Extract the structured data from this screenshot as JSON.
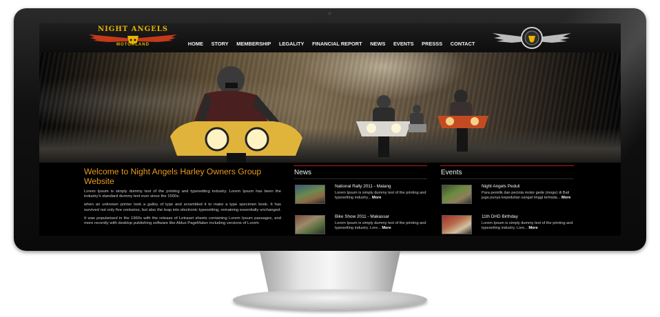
{
  "site": {
    "logo_title": "NIGHT ANGELS",
    "logo_subtitle": "MOTORLAND",
    "emblem_icon": "winged-eagle-badge-icon"
  },
  "nav": {
    "items": [
      "HOME",
      "STORY",
      "MEMBERSHIP",
      "LEGALITY",
      "FINANCIAL REPORT",
      "NEWS",
      "EVENTS",
      "PRESSS",
      "CONTACT"
    ]
  },
  "welcome": {
    "title": "Welcome to Night Angels Harley Owners Group Website",
    "paragraphs": [
      "Lorem Ipsum is simply dummy text of the printing and typesetting industry. Lorem Ipsum has been the industry's standard dummy text ever since the 1500s.",
      "when an unknown printer took a galley of type and scrambled it to make a type specimen book. It has survived not only five centuries, but also the leap into electronic typesetting, remaining essentially unchanged.",
      "It was popularised in the 1960s with the release of Letraset sheets containing Lorem Ipsum passages, and more recently with desktop publishing software like Aldus PageMaker including versions of Lorem"
    ]
  },
  "news": {
    "heading": "News",
    "items": [
      {
        "title": "National Rally 2011 - Malang",
        "text": "Lorem Ipsum is simply dummy text of the printing and typesetting industry...",
        "more": "More"
      },
      {
        "title": "Bike Show 2011 - Makassar",
        "text": "Lorem Ipsum is simply dummy text of the printing and typesetting industry. Lore...",
        "more": "More"
      }
    ]
  },
  "events": {
    "heading": "Events",
    "items": [
      {
        "title": "Night Angels Peduli",
        "text": "Para pemilik dan pecinta motor gede (moge) di Bali juga punya kepedulian sangat tinggi terhada...",
        "more": "More"
      },
      {
        "title": "11th DHD Birthday",
        "text": "Lorem Ipsum is simply dummy text of the printing and typesetting industry. Lore...",
        "more": "More"
      }
    ]
  },
  "colors": {
    "accent_orange": "#e89a1c",
    "heading_rule_red": "#b41e1e",
    "logo_gold": "#e8b400"
  }
}
